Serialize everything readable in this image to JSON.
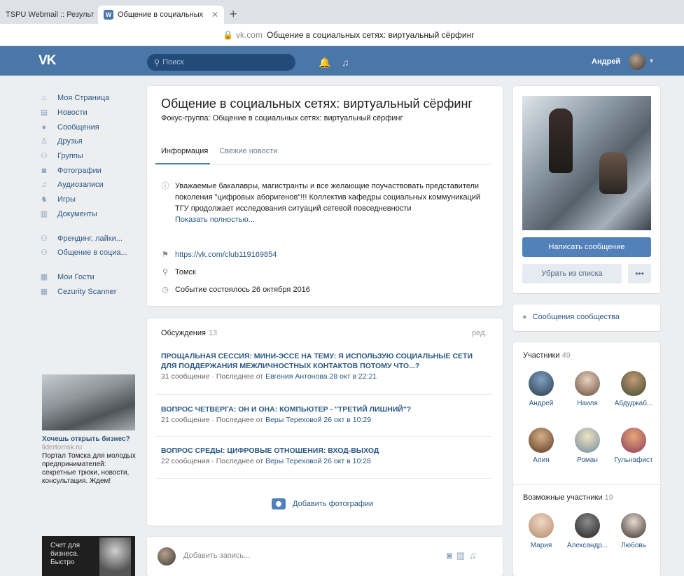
{
  "browser": {
    "tabs": [
      {
        "title": "TSPU Webmail :: Результ",
        "active": false
      },
      {
        "title": "Общение в социальных",
        "active": true
      }
    ],
    "new_tab": "+",
    "host": "vk.com",
    "page_title": "Общение в социальных сетях: виртуальный сёрфинг"
  },
  "header": {
    "logo": "VK",
    "search_placeholder": "Поиск",
    "user_name": "Андрей"
  },
  "menu": {
    "items": [
      {
        "label": "Моя Страница",
        "icon": "home-icon"
      },
      {
        "label": "Новости",
        "icon": "news-icon"
      },
      {
        "label": "Сообщения",
        "icon": "messages-icon"
      },
      {
        "label": "Друзья",
        "icon": "friends-icon"
      },
      {
        "label": "Группы",
        "icon": "groups-icon"
      },
      {
        "label": "Фотографии",
        "icon": "camera-icon"
      },
      {
        "label": "Аудиозаписи",
        "icon": "music-icon"
      },
      {
        "label": "Игры",
        "icon": "games-icon"
      },
      {
        "label": "Документы",
        "icon": "document-icon"
      }
    ],
    "groups": [
      {
        "label": "Френдинг, лайки...",
        "icon": "groups-icon"
      },
      {
        "label": "Общение в социа...",
        "icon": "groups-icon"
      }
    ],
    "apps": [
      {
        "label": "Мои Гости",
        "icon": "app-icon"
      },
      {
        "label": "Cezurity Scanner",
        "icon": "app-icon"
      }
    ]
  },
  "ads": {
    "ad1": {
      "title": "Хочешь открыть бизнес?",
      "host": "lidertomsk.ru",
      "text": "Портал Томска для молодых предпринимателей: секретные трюки, новости, консультация. Ждем!"
    },
    "ad2": {
      "text": "Счет для бизнеса. Быстро"
    }
  },
  "group": {
    "title": "Общение в социальных сетях: виртуальный сёрфинг",
    "subtitle": "Фокус-группа: Общение в социальных сетях: виртуальный сёрфинг",
    "tabs": [
      "Информация",
      "Свежие новости"
    ],
    "description": "Уважаемые бакалавры, магистранты и все желающие поучаствовать представители поколения \"цифровых аборигенов\"!!! Коллектив кафедры социальных коммуникаций ТГУ продолжает исследования ситуаций сетевой повседневности",
    "show_more": "Показать полностью...",
    "link": "https://vk.com/club119169854",
    "city": "Томск",
    "event": "Событие состоялось 26 октября 2016"
  },
  "discussions": {
    "label": "Обсуждения",
    "count": "13",
    "edit": "ред.",
    "topics": [
      {
        "title": "ПРОЩАЛЬНАЯ СЕССИЯ: МИНИ-ЭССЕ НА ТЕМУ: Я ИСПОЛЬЗУЮ СОЦИАЛЬНЫЕ СЕТИ ДЛЯ ПОДДЕРЖАНИЯ МЕЖЛИЧНОСТНЫХ КОНТАКТОВ ПОТОМУ ЧТО...?",
        "meta": "31 сообщение · Последнее от",
        "who": "Евгения Антонова 28 окт в 22:21"
      },
      {
        "title": "ВОПРОС ЧЕТВЕРГА: ОН И ОНА: КОМПЬЮТЕР - \"ТРЕТИЙ ЛИШНИЙ\"?",
        "meta": "21 сообщение · Последнее от",
        "who": "Веры Тереховой 26 окт в 10:29"
      },
      {
        "title": "ВОПРОС СРЕДЫ: ЦИФРОВЫЕ ОТНОШЕНИЯ: ВХОД-ВЫХОД",
        "meta": "22 сообщения · Последнее от",
        "who": "Веры Тереховой 26 окт в 10:28"
      }
    ]
  },
  "add_photos": "Добавить фотографии",
  "post": {
    "placeholder": "Добавить запись..."
  },
  "actions": {
    "write_message": "Написать сообщение",
    "remove": "Убрать из списка",
    "more": "•••"
  },
  "community_messages": "Сообщения сообщества",
  "members": {
    "label": "Участники",
    "count": "49",
    "list": [
      "Андрей",
      "Наиля",
      "Абдуджаб...",
      "Алия",
      "Роман",
      "Гульнафист"
    ]
  },
  "possible_members": {
    "label": "Возможные участники",
    "count": "19",
    "list": [
      "Мария",
      "Александр...",
      "Любовь"
    ]
  },
  "colors": {
    "brand": "#4a76a8",
    "link": "#2a5885",
    "button": "#5181b8",
    "background": "#edeef0"
  }
}
